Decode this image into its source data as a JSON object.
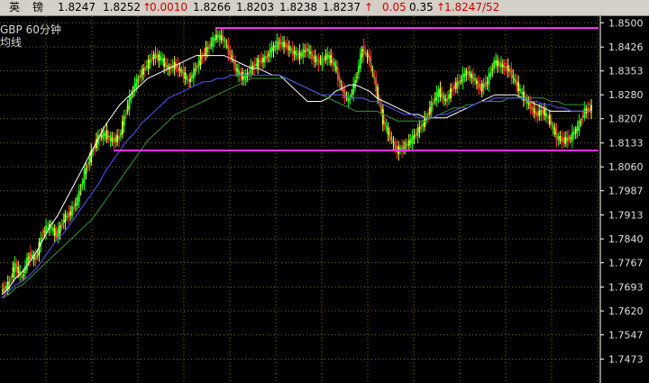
{
  "quote": {
    "name_1": "英",
    "name_2": "镑",
    "open": "1.8247",
    "high_price": "1.8252",
    "change": "0.0010",
    "ask": "1.8266",
    "bid": "1.8203",
    "last": "1.8238",
    "prev": "1.8237",
    "arrow": "↑",
    "pct": "0.05",
    "range": "0.35",
    "last_tick": "1.8247/52"
  },
  "colors": {
    "up": "#cc0000",
    "bar_bg": "#d4d0c8",
    "grid": "#8a6a00",
    "resistance": "#ff33ff",
    "ma_white": "#ffffff",
    "ma_blue": "#5555ff",
    "ma_green": "#339933",
    "candle_green": "#22ff22",
    "candle_red": "#ff3030",
    "candle_yellow": "#ffff33"
  },
  "chart_data": {
    "type": "line",
    "title": "GBP  60分钟",
    "subtitle": "均线",
    "ylim": [
      1.74,
      1.852
    ],
    "yticks": [
      "1.8500",
      "1.8426",
      "1.8353",
      "1.8280",
      "1.8207",
      "1.8133",
      "1.8060",
      "1.7987",
      "1.7913",
      "1.7840",
      "1.7767",
      "1.7693",
      "1.7620",
      "1.7547",
      "1.7473"
    ],
    "grid": true,
    "series": [
      {
        "values": [
          1.768,
          1.77,
          1.776,
          1.772,
          1.779,
          1.778,
          1.786,
          1.788,
          1.785,
          1.79,
          1.792,
          1.796,
          1.804,
          1.81,
          1.815,
          1.816,
          1.814,
          1.815,
          1.823,
          1.83,
          1.834,
          1.837,
          1.84,
          1.839,
          1.836,
          1.837,
          1.835,
          1.832,
          1.836,
          1.84,
          1.843,
          1.846,
          1.845,
          1.84,
          1.835,
          1.833,
          1.836,
          1.838,
          1.839,
          1.842,
          1.844,
          1.843,
          1.841,
          1.84,
          1.842,
          1.839,
          1.838,
          1.84,
          1.837,
          1.83,
          1.826,
          1.832,
          1.842,
          1.839,
          1.83,
          1.82,
          1.815,
          1.811,
          1.812,
          1.814,
          1.817,
          1.82,
          1.825,
          1.829,
          1.826,
          1.83,
          1.832,
          1.835,
          1.833,
          1.83,
          1.832,
          1.838,
          1.837,
          1.836,
          1.832,
          1.828,
          1.825,
          1.822,
          1.823,
          1.82,
          1.815,
          1.814,
          1.815,
          1.818,
          1.823,
          1.824
        ]
      },
      {
        "values": [
          1.767,
          1.769,
          1.772,
          1.774,
          1.777,
          1.78,
          1.784,
          1.788,
          1.791,
          1.795,
          1.799,
          1.803,
          1.807,
          1.811,
          1.815,
          1.819,
          1.822,
          1.825,
          1.827,
          1.829,
          1.831,
          1.833,
          1.834,
          1.835,
          1.836,
          1.837,
          1.838,
          1.839,
          1.84,
          1.84,
          1.84,
          1.84,
          1.84,
          1.839,
          1.838,
          1.837,
          1.836,
          1.836,
          1.835,
          1.834,
          1.834,
          1.832,
          1.83,
          1.828,
          1.826,
          1.826,
          1.826,
          1.827,
          1.829,
          1.83,
          1.831,
          1.831,
          1.83,
          1.829,
          1.827,
          1.826,
          1.825,
          1.824,
          1.823,
          1.822,
          1.822,
          1.821,
          1.821,
          1.821,
          1.821,
          1.822,
          1.823,
          1.824,
          1.825,
          1.826,
          1.827,
          1.828,
          1.828,
          1.828,
          1.828,
          1.827,
          1.826,
          1.825,
          1.824,
          1.823,
          1.823,
          1.823,
          1.823,
          1.823,
          1.823,
          1.823
        ]
      },
      {
        "values": [
          1.766,
          1.767,
          1.769,
          1.77,
          1.772,
          1.774,
          1.776,
          1.778,
          1.78,
          1.782,
          1.784,
          1.786,
          1.788,
          1.79,
          1.793,
          1.796,
          1.799,
          1.802,
          1.805,
          1.808,
          1.811,
          1.814,
          1.816,
          1.818,
          1.82,
          1.822,
          1.823,
          1.824,
          1.825,
          1.826,
          1.827,
          1.828,
          1.829,
          1.83,
          1.831,
          1.832,
          1.833,
          1.833,
          1.833,
          1.833,
          1.833,
          1.833,
          1.832,
          1.831,
          1.83,
          1.829,
          1.828,
          1.827,
          1.826,
          1.825,
          1.824,
          1.823,
          1.823,
          1.823,
          1.823,
          1.822,
          1.821,
          1.82,
          1.82,
          1.82,
          1.82,
          1.82,
          1.821,
          1.822,
          1.823,
          1.824,
          1.824,
          1.825,
          1.825,
          1.826,
          1.826,
          1.826,
          1.826,
          1.827,
          1.827,
          1.827,
          1.827,
          1.827,
          1.827,
          1.826,
          1.826,
          1.825,
          1.825,
          1.825,
          1.825,
          1.825
        ]
      },
      {
        "values": [
          1.766,
          1.768,
          1.77,
          1.771,
          1.773,
          1.775,
          1.778,
          1.781,
          1.784,
          1.786,
          1.789,
          1.792,
          1.795,
          1.798,
          1.801,
          1.805,
          1.808,
          1.811,
          1.814,
          1.816,
          1.819,
          1.821,
          1.823,
          1.825,
          1.827,
          1.828,
          1.829,
          1.83,
          1.831,
          1.832,
          1.832,
          1.833,
          1.833,
          1.834,
          1.834,
          1.834,
          1.834,
          1.834,
          1.834,
          1.834,
          1.834,
          1.833,
          1.832,
          1.831,
          1.83,
          1.829,
          1.828,
          1.828,
          1.828,
          1.828,
          1.827,
          1.827,
          1.827,
          1.826,
          1.826,
          1.825,
          1.824,
          1.823,
          1.822,
          1.822,
          1.821,
          1.821,
          1.821,
          1.822,
          1.822,
          1.823,
          1.824,
          1.824,
          1.825,
          1.826,
          1.826,
          1.827,
          1.827,
          1.827,
          1.827,
          1.827,
          1.826,
          1.826,
          1.825,
          1.825,
          1.824,
          1.824,
          1.823,
          1.823,
          1.823,
          1.823
        ]
      }
    ],
    "reference_lines": [
      {
        "type": "horizontal",
        "value": 1.8484,
        "x_from": 0.36,
        "x_to": 1.0
      },
      {
        "type": "horizontal",
        "value": 1.811,
        "x_from": 0.19,
        "x_to": 1.0
      }
    ]
  }
}
